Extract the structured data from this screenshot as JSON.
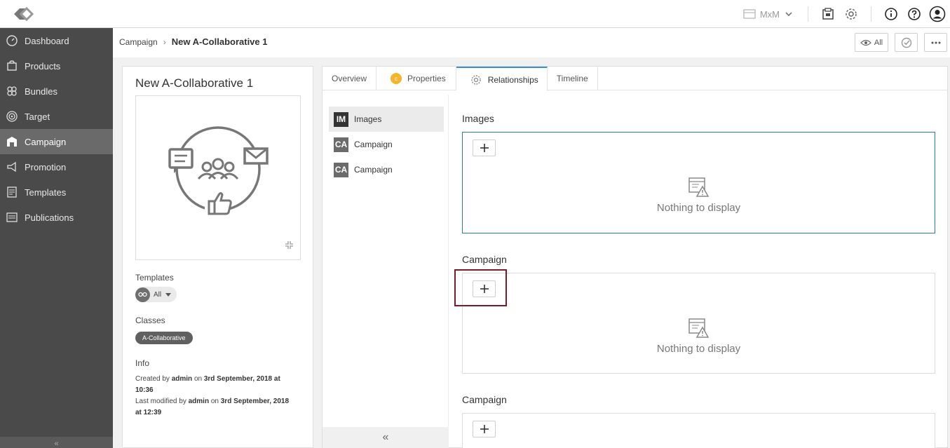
{
  "topbar": {
    "store_label": "MxM",
    "icons": [
      "catalog-icon",
      "settings-icon",
      "info-icon",
      "help-icon",
      "user-icon"
    ]
  },
  "sidebar": {
    "items": [
      {
        "label": "Dashboard",
        "icon": "dashboard-icon"
      },
      {
        "label": "Products",
        "icon": "products-icon"
      },
      {
        "label": "Bundles",
        "icon": "bundles-icon"
      },
      {
        "label": "Target",
        "icon": "target-icon"
      },
      {
        "label": "Campaign",
        "icon": "campaign-icon",
        "active": true
      },
      {
        "label": "Promotion",
        "icon": "promotion-icon"
      },
      {
        "label": "Templates",
        "icon": "templates-icon"
      },
      {
        "label": "Publications",
        "icon": "publications-icon"
      }
    ],
    "collapse": "«"
  },
  "breadcrumb": {
    "parent": "Campaign",
    "separator": "›",
    "current": "New A-Collaborative 1"
  },
  "actions": {
    "view_all": "All"
  },
  "entity": {
    "title": "New A-Collaborative 1",
    "templates_label": "Templates",
    "templates_value": "All",
    "classes_label": "Classes",
    "class_badge": "A-Collaborative",
    "info_label": "Info",
    "info": {
      "created_prefix": "Created by",
      "created_by": "admin",
      "created_on": "on",
      "created_date": "3rd September, 2018 at 10:36",
      "modified_prefix": "Last modified by",
      "modified_by": "admin",
      "modified_on": "on",
      "modified_date": "3rd September, 2018 at 12:39"
    }
  },
  "tabs": [
    {
      "label": "Overview"
    },
    {
      "label": "Properties",
      "badge": "c"
    },
    {
      "label": "Relationships",
      "active": true
    },
    {
      "label": "Timeline"
    }
  ],
  "relationships_nav": [
    {
      "code": "IM",
      "label": "Images",
      "active": true
    },
    {
      "code": "CA",
      "label": "Campaign"
    },
    {
      "code": "CA",
      "label": "Campaign"
    }
  ],
  "relnav_collapse": "«",
  "sections": [
    {
      "title": "Images",
      "empty_text": "Nothing to display"
    },
    {
      "title": "Campaign",
      "empty_text": "Nothing to display"
    },
    {
      "title": "Campaign",
      "empty_text": ""
    }
  ],
  "colors": {
    "sidebar_bg": "#4a4a4a",
    "accent": "#3a8fd0",
    "focus_border": "#2f7d95",
    "highlight": "#7a1a2a",
    "properties_badge": "#f2b52b"
  }
}
